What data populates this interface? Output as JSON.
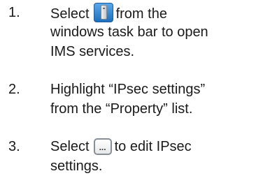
{
  "steps": [
    {
      "number": "1.",
      "before_icon": "Select",
      "icon": "ims-taskbar-icon",
      "after_icon": "from the",
      "line2": "windows task bar to open",
      "line3": "IMS services."
    },
    {
      "number": "2.",
      "line1": "Highlight “IPsec settings”",
      "line2": "from the “Property” list."
    },
    {
      "number": "3.",
      "before_icon": "Select",
      "icon": "ellipsis-button-icon",
      "icon_glyph": "...",
      "after_icon": "to edit IPsec",
      "line2": "settings."
    }
  ]
}
